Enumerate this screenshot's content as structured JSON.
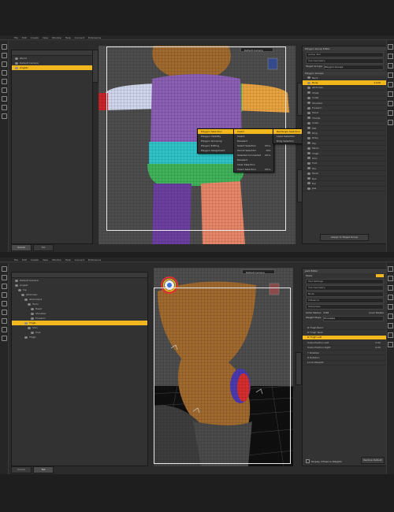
{
  "menu": [
    "File",
    "Edit",
    "Create",
    "View",
    "Window",
    "Help",
    "Connect",
    "Extensions"
  ],
  "shot1": {
    "scene_items": [
      {
        "label": "World",
        "selected": false
      },
      {
        "label": "Default Camera",
        "selected": false
      },
      {
        "label": "Angelic",
        "selected": true
      }
    ],
    "viewport_camera": "Default Camera",
    "pane": {
      "tab": "Polygon Group Editor",
      "title": "Polygon Group Editor",
      "tool_label": "Active Tool",
      "use_geometry": "Use Geometry",
      "target_label": "Target Groups",
      "target_value": "Polygon Groups",
      "header": "Polygon Groups",
      "rows": [
        {
          "label": "Neck",
          "value": "",
          "selected": false
        },
        {
          "label": "Body",
          "value": "2,026",
          "selected": true
        },
        {
          "label": "Abdomen",
          "value": "",
          "selected": false
        },
        {
          "label": "Chest",
          "value": "",
          "selected": false
        },
        {
          "label": "Collar",
          "value": "",
          "selected": false
        },
        {
          "label": "Shoulder",
          "value": "",
          "selected": false
        },
        {
          "label": "Forearm",
          "value": "",
          "selected": false
        },
        {
          "label": "Hand",
          "value": "",
          "selected": false
        },
        {
          "label": "Thumb",
          "value": "",
          "selected": false
        },
        {
          "label": "Index",
          "value": "",
          "selected": false
        },
        {
          "label": "Mid",
          "value": "",
          "selected": false
        },
        {
          "label": "Ring",
          "value": "",
          "selected": false
        },
        {
          "label": "Pinky",
          "value": "",
          "selected": false
        },
        {
          "label": "Hip",
          "value": "",
          "selected": false
        },
        {
          "label": "Pelvis",
          "value": "",
          "selected": false
        },
        {
          "label": "Thigh",
          "value": "",
          "selected": false
        },
        {
          "label": "Shin",
          "value": "",
          "selected": false
        },
        {
          "label": "Foot",
          "value": "",
          "selected": false
        },
        {
          "label": "Toe",
          "value": "",
          "selected": false
        },
        {
          "label": "Head",
          "value": "",
          "selected": false
        },
        {
          "label": "Eye",
          "value": "",
          "selected": false
        },
        {
          "label": "Ear",
          "value": "",
          "selected": false
        },
        {
          "label": "Jaw",
          "value": "",
          "selected": false
        }
      ],
      "button": "Assign to Target Group"
    },
    "bottom_tabs": [
      "Unlock",
      "Tab"
    ],
    "context_menu": {
      "col1": [
        "Polygon Selection",
        "Polygon Visibility",
        "Polygon Grouping",
        "Polygon Editing",
        "Polygon Assignment"
      ],
      "col2": [
        {
          "label": "Invert",
          "shortcut": ""
        },
        {
          "label": "Select",
          "shortcut": ""
        },
        {
          "label": "Deselect",
          "shortcut": ""
        },
        {
          "label": "Select Selection",
          "shortcut": "Ctrl+"
        },
        {
          "label": "Shrink Selection",
          "shortcut": "Ctrl-"
        },
        {
          "label": "Selected Connected",
          "shortcut": "Ctrl+"
        },
        {
          "label": "Deselect",
          "shortcut": ""
        },
        {
          "label": "Clear Selection",
          "shortcut": ""
        },
        {
          "label": "Invert Selection",
          "shortcut": "Ctrl+"
        }
      ],
      "col3": [
        "Rectangle Selection",
        "Lasso Selection",
        "Drag Selection"
      ]
    }
  },
  "shot2": {
    "scene_items": [
      {
        "label": "Default Camera",
        "selected": false
      },
      {
        "label": "Angelic",
        "selected": false
      },
      {
        "label": "hip",
        "selected": false
      },
      {
        "label": "Abdomen",
        "selected": false
      },
      {
        "label": "Abdomen2",
        "selected": false
      },
      {
        "label": "Torso",
        "selected": false
      },
      {
        "label": "Head",
        "selected": false
      },
      {
        "label": "Shoulder",
        "selected": false
      },
      {
        "label": "Forearm",
        "selected": false
      },
      {
        "label": "Thigh",
        "selected": true
      },
      {
        "label": "Shin",
        "selected": false
      },
      {
        "label": "Foot",
        "selected": false
      },
      {
        "label": "Thigh",
        "selected": false
      }
    ],
    "viewport_camera": "Default Camera",
    "pane": {
      "tab": "Joint Editor",
      "title": "Joint Editor",
      "mode": "Mode:",
      "rows_top": [
        "Tool Settings",
        "Use Geometry",
        "Node",
        "Influence",
        "Sharpness"
      ],
      "falloff_label": "Outer Radius",
      "falloff_value": "0.00",
      "inner_label": "Inner Radius",
      "weight_label": "Weight Maps",
      "weight_value": "Envelope",
      "rows_bottom": [
        {
          "label": "R Thigh Bend",
          "selected": false
        },
        {
          "label": "R Thigh Twist",
          "selected": false
        },
        {
          "label": "R Thigh Left",
          "selected": true
        },
        {
          "label": "Scale Position Left",
          "value": "0.00",
          "selected": false
        },
        {
          "label": "Scale Position Right",
          "value": "0.00",
          "selected": false
        },
        {
          "label": "Y Rotation",
          "value": "",
          "selected": false
        },
        {
          "label": "Z Rotation",
          "value": "",
          "selected": false
        },
        {
          "label": "Local Weights",
          "value": "",
          "selected": false
        }
      ],
      "checkbox": "Display Influence Weights",
      "button": "Restore Default"
    },
    "bottom_tabs": [
      "Unlock",
      "Tab"
    ]
  },
  "colors": {
    "accent": "#f2b71c",
    "purple": "#6b3fa0",
    "cyan": "#2fc3c8",
    "green": "#3fb25a",
    "orange": "#e8a340",
    "pink": "#e78569",
    "red": "#c8232a",
    "brown": "#a0692e"
  }
}
